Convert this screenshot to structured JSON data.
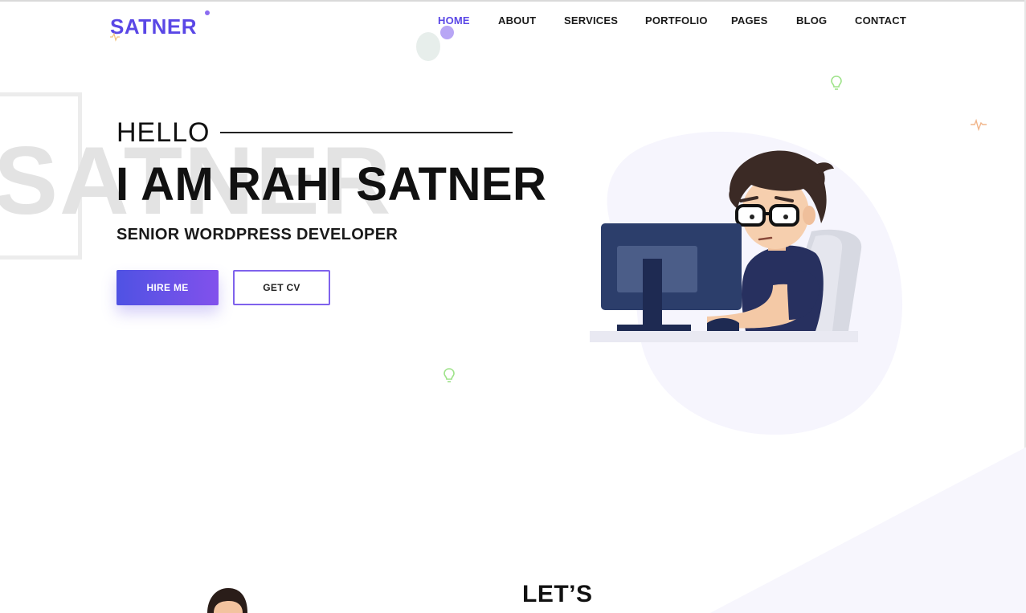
{
  "header": {
    "logo_text": "SATNER",
    "nav": [
      {
        "label": "HOME",
        "active": true
      },
      {
        "label": "ABOUT",
        "active": false
      },
      {
        "label": "SERVICES",
        "active": false
      },
      {
        "label": "PORTFOLIO",
        "active": false
      },
      {
        "label": "PAGES",
        "active": false
      },
      {
        "label": "BLOG",
        "active": false
      },
      {
        "label": "CONTACT",
        "active": false
      }
    ]
  },
  "hero": {
    "watermark": "SATNER",
    "greeting": "HELLO",
    "headline": "I AM RAHI SATNER",
    "subtitle": "SENIOR WORDPRESS DEVELOPER",
    "hire_button": "HIRE ME",
    "cv_button": "GET CV"
  },
  "next_section": {
    "heading": "LET’S"
  },
  "colors": {
    "brand": "#5a47e6",
    "accent_gradient_start": "#4f52e3",
    "accent_gradient_end": "#8251ec",
    "text": "#111111"
  },
  "icons": [
    "lightbulb-icon",
    "pulse-icon",
    "spark-icon"
  ]
}
